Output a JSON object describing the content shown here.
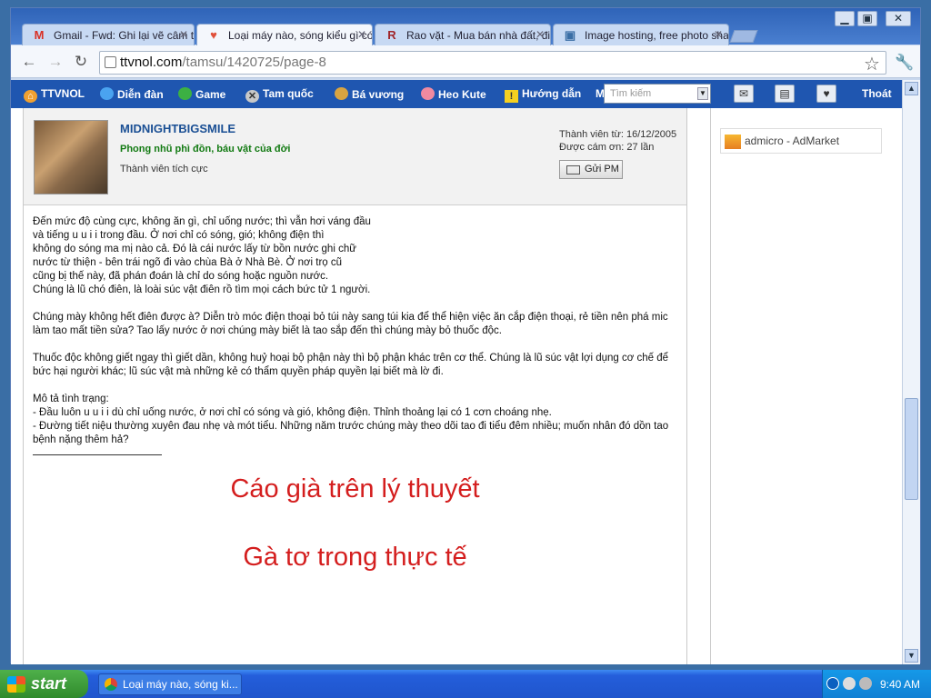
{
  "tabs": [
    {
      "icon": "gmail-icon",
      "glyph": "M",
      "label": "Gmail - Fwd: Ghi lại vẽ câm tả -"
    },
    {
      "icon": "heart-icon",
      "glyph": "♥",
      "label": "Loại máy nào, sóng kiểu gì có t"
    },
    {
      "icon": "raovat-icon",
      "glyph": "R",
      "label": "Rao vặt - Mua bán nhà đất, đi"
    },
    {
      "icon": "image-icon",
      "glyph": "▣",
      "label": "Image hosting, free photo sha"
    }
  ],
  "address": {
    "domain": "ttvnol.com",
    "path": "/tamsu/1420725/page-8"
  },
  "nav": {
    "items": [
      "TTVNOL",
      "Diễn đàn",
      "Game",
      "Tam quốc",
      "Bá vương",
      "Heo Kute",
      "Hướng dẫn"
    ],
    "overflow": "M",
    "search_text": "Tìm kiếm",
    "logout": "Thoát"
  },
  "post": {
    "username": "MIDNIGHTBIGSMILE",
    "user_title": "Phong nhũ phì đồn, báu vật của đời",
    "rank": "Thành viên tích cực",
    "joined": "Thành viên từ: 16/12/2005",
    "thanked": "Được cám ơn: 27 lần",
    "pm_button": "Gửi PM",
    "paragraphs": [
      "Đến mức độ cùng cực, không ăn gì, chỉ uống nước; thì vẫn hơi váng đầu\nvà tiếng u u i i trong đầu. Ở nơi chỉ có sóng, gió; không điện thì\nkhông do sóng ma mị nào cả. Đó là cái nước lấy từ bồn nước ghi chữ\nnước từ thiện - bên trái ngõ đi vào chùa Bà ở Nhà Bè. Ở nơi trọ cũ\ncũng bị thế này, đã phán đoán là chỉ do sóng hoặc nguồn nước.\nChúng là lũ chó điên, là loài súc vật điên rồ tìm mọi cách bức tử 1 người.",
      "Chúng mày không hết điên được à? Diễn trò móc điện thoại bỏ túi này sang túi kia để thể hiện việc ăn cắp điện thoại, rẻ tiền nên phá mic làm tao mất tiền sửa? Tao lấy nước ở nơi chúng mày biết là tao sắp đến thì chúng mày bỏ thuốc độc.",
      "Thuốc độc không giết ngay thì giết dần, không huỷ hoại bộ phận này thì bộ phận khác trên cơ thể. Chúng là lũ súc vật lợi dụng cơ chế để bức hại người khác; lũ súc vật mà những kẻ có thẩm quyền pháp quyền lại biết mà lờ đi.",
      "Mô tả tình trạng:\n- Đầu luôn u u i i dù chỉ uống nước, ở nơi chỉ có sóng và gió, không điện. Thỉnh thoảng lại có 1 cơn choáng nhẹ.\n- Đường tiết niệu thường xuyên đau nhẹ và mót tiểu. Những năm trước chúng mày theo dõi tao đi tiểu đêm nhiều; muốn nhân đó dồn tao bệnh nặng thêm hả?"
    ],
    "signature_line1": "Cáo già trên lý thuyết",
    "signature_line2": "Gà tơ trong thực tế"
  },
  "ad": {
    "label": "admicro - AdMarket"
  },
  "taskbar": {
    "start": "start",
    "task_label": "Loại máy nào, sóng ki...",
    "clock": "9:40 AM"
  },
  "colors": {
    "signature": "#d41e1e",
    "username": "#1a4f94",
    "user_title": "#127a12",
    "nav_bg": "#1f56b0"
  }
}
